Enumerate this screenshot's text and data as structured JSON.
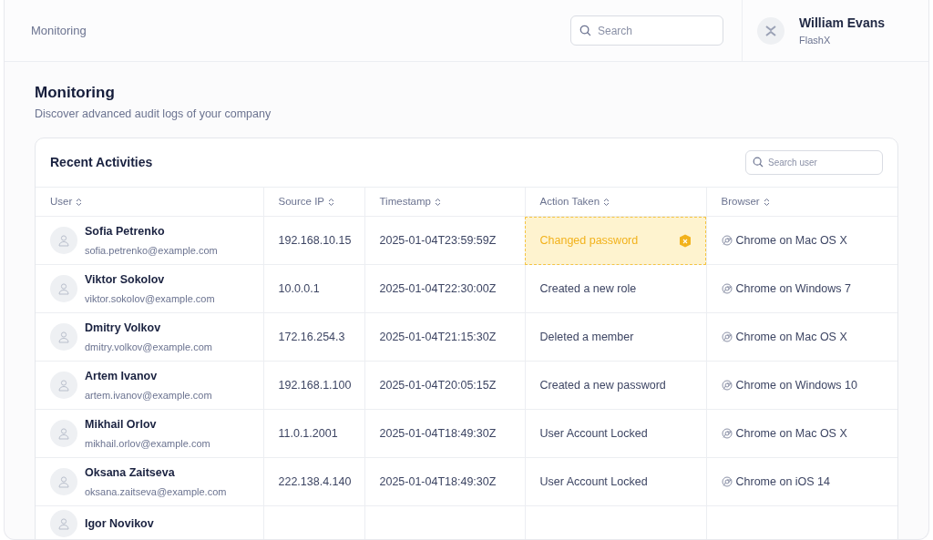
{
  "header": {
    "breadcrumb": "Monitoring",
    "search": {
      "placeholder": "Search"
    },
    "user": {
      "name": "William Evans",
      "company": "FlashX"
    }
  },
  "page": {
    "title": "Monitoring",
    "subtitle": "Discover advanced audit logs of your company"
  },
  "card": {
    "title": "Recent Activities",
    "search": {
      "placeholder": "Search user"
    },
    "columns": [
      "User",
      "Source IP",
      "Timestamp",
      "Action Taken",
      "Browser"
    ],
    "rows": [
      {
        "name": "Sofia Petrenko",
        "email": "sofia.petrenko@example.com",
        "ip": "192.168.10.15",
        "timestamp": "2025-01-04T23:59:59Z",
        "action": "Changed password",
        "highlighted": true,
        "browser": "Chrome on Mac OS X"
      },
      {
        "name": "Viktor Sokolov",
        "email": "viktor.sokolov@example.com",
        "ip": "10.0.0.1",
        "timestamp": "2025-01-04T22:30:00Z",
        "action": "Created a new role",
        "highlighted": false,
        "browser": "Chrome on Windows 7"
      },
      {
        "name": "Dmitry Volkov",
        "email": "dmitry.volkov@example.com",
        "ip": "172.16.254.3",
        "timestamp": "2025-01-04T21:15:30Z",
        "action": "Deleted a member",
        "highlighted": false,
        "browser": "Chrome on Mac OS X"
      },
      {
        "name": "Artem Ivanov",
        "email": "artem.ivanov@example.com",
        "ip": "192.168.1.100",
        "timestamp": "2025-01-04T20:05:15Z",
        "action": "Created a new password",
        "highlighted": false,
        "browser": "Chrome on Windows 10"
      },
      {
        "name": "Mikhail Orlov",
        "email": "mikhail.orlov@example.com",
        "ip": "11.0.1.2001",
        "timestamp": "2025-01-04T18:49:30Z",
        "action": "User Account Locked",
        "highlighted": false,
        "browser": "Chrome on Mac OS X"
      },
      {
        "name": "Oksana Zaitseva",
        "email": "oksana.zaitseva@example.com",
        "ip": "222.138.4.140",
        "timestamp": "2025-01-04T18:49:30Z",
        "action": "User Account Locked",
        "highlighted": false,
        "browser": "Chrome on iOS 14"
      },
      {
        "name": "Igor Novikov"
      }
    ]
  }
}
